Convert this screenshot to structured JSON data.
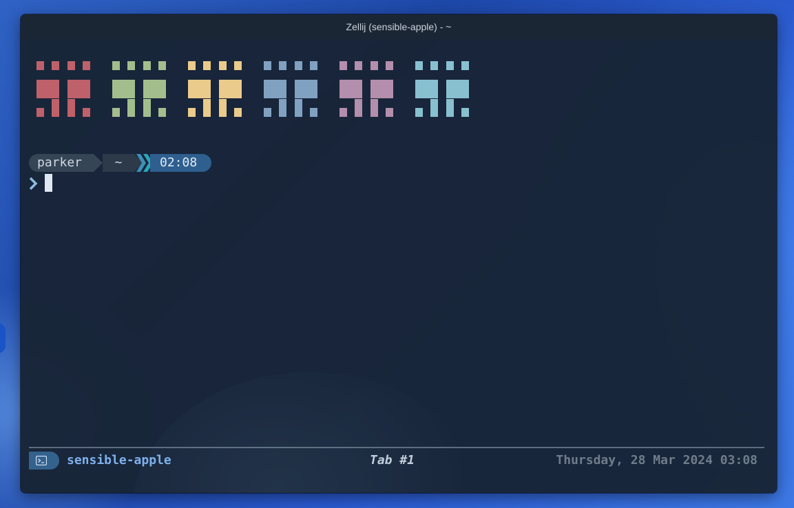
{
  "window": {
    "title": "Zellij (sensible-apple) - ~"
  },
  "art": {
    "colors": [
      "#bf616a",
      "#a3be8c",
      "#ebcb8b",
      "#81a1c1",
      "#b48ead",
      "#88c0d0"
    ],
    "icon": "pixel-space-invader-icon"
  },
  "prompt": {
    "user": "parker",
    "dir": "~",
    "time": "02:08",
    "prompt_char_icon": "chevron-right-icon",
    "colors": {
      "user_bg": "#364556",
      "dir_bg": "#2c3a4a",
      "time_bg": "#2e5f8f",
      "chevron_1": "#3d8fb8",
      "chevron_2": "#2aa6b8",
      "prompt_char": "#8fbcdf"
    }
  },
  "statusbar": {
    "session_icon": "terminal-icon",
    "session": "sensible-apple",
    "tab": "Tab #1",
    "datetime": "Thursday, 28 Mar 2024 03:08"
  }
}
